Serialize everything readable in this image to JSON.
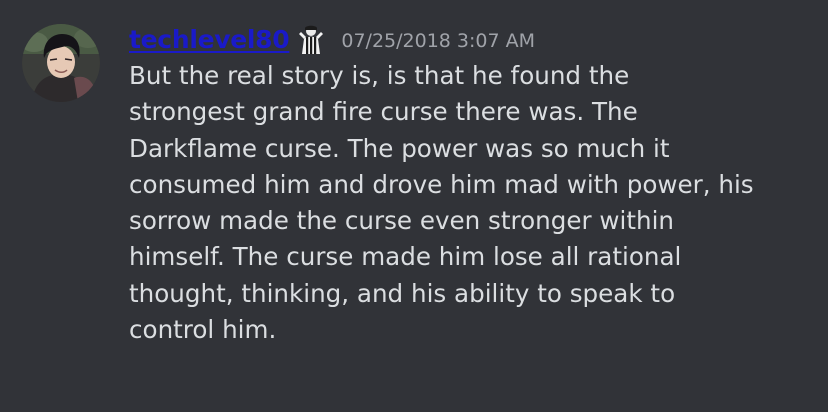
{
  "message": {
    "author": {
      "name": "techlevel80",
      "name_color": "#1a1ac8",
      "avatar_icon": "avatar-dark-haired-character",
      "role_icon": "referee-icon"
    },
    "timestamp": "07/25/2018 3:07 AM",
    "content_lines": [
      "But the real story is, is that he found the",
      "strongest grand fire curse there was. The",
      "Darkflame curse. The power was so much it",
      "consumed him and drove him mad with power, his",
      "sorrow made the curse even stronger within",
      "himself. The curse made him lose all rational",
      "thought, thinking, and his ability to speak to",
      "control him."
    ]
  },
  "theme": {
    "background": "#313338",
    "text": "#dbdee1",
    "timestamp": "#a0a3a9"
  }
}
